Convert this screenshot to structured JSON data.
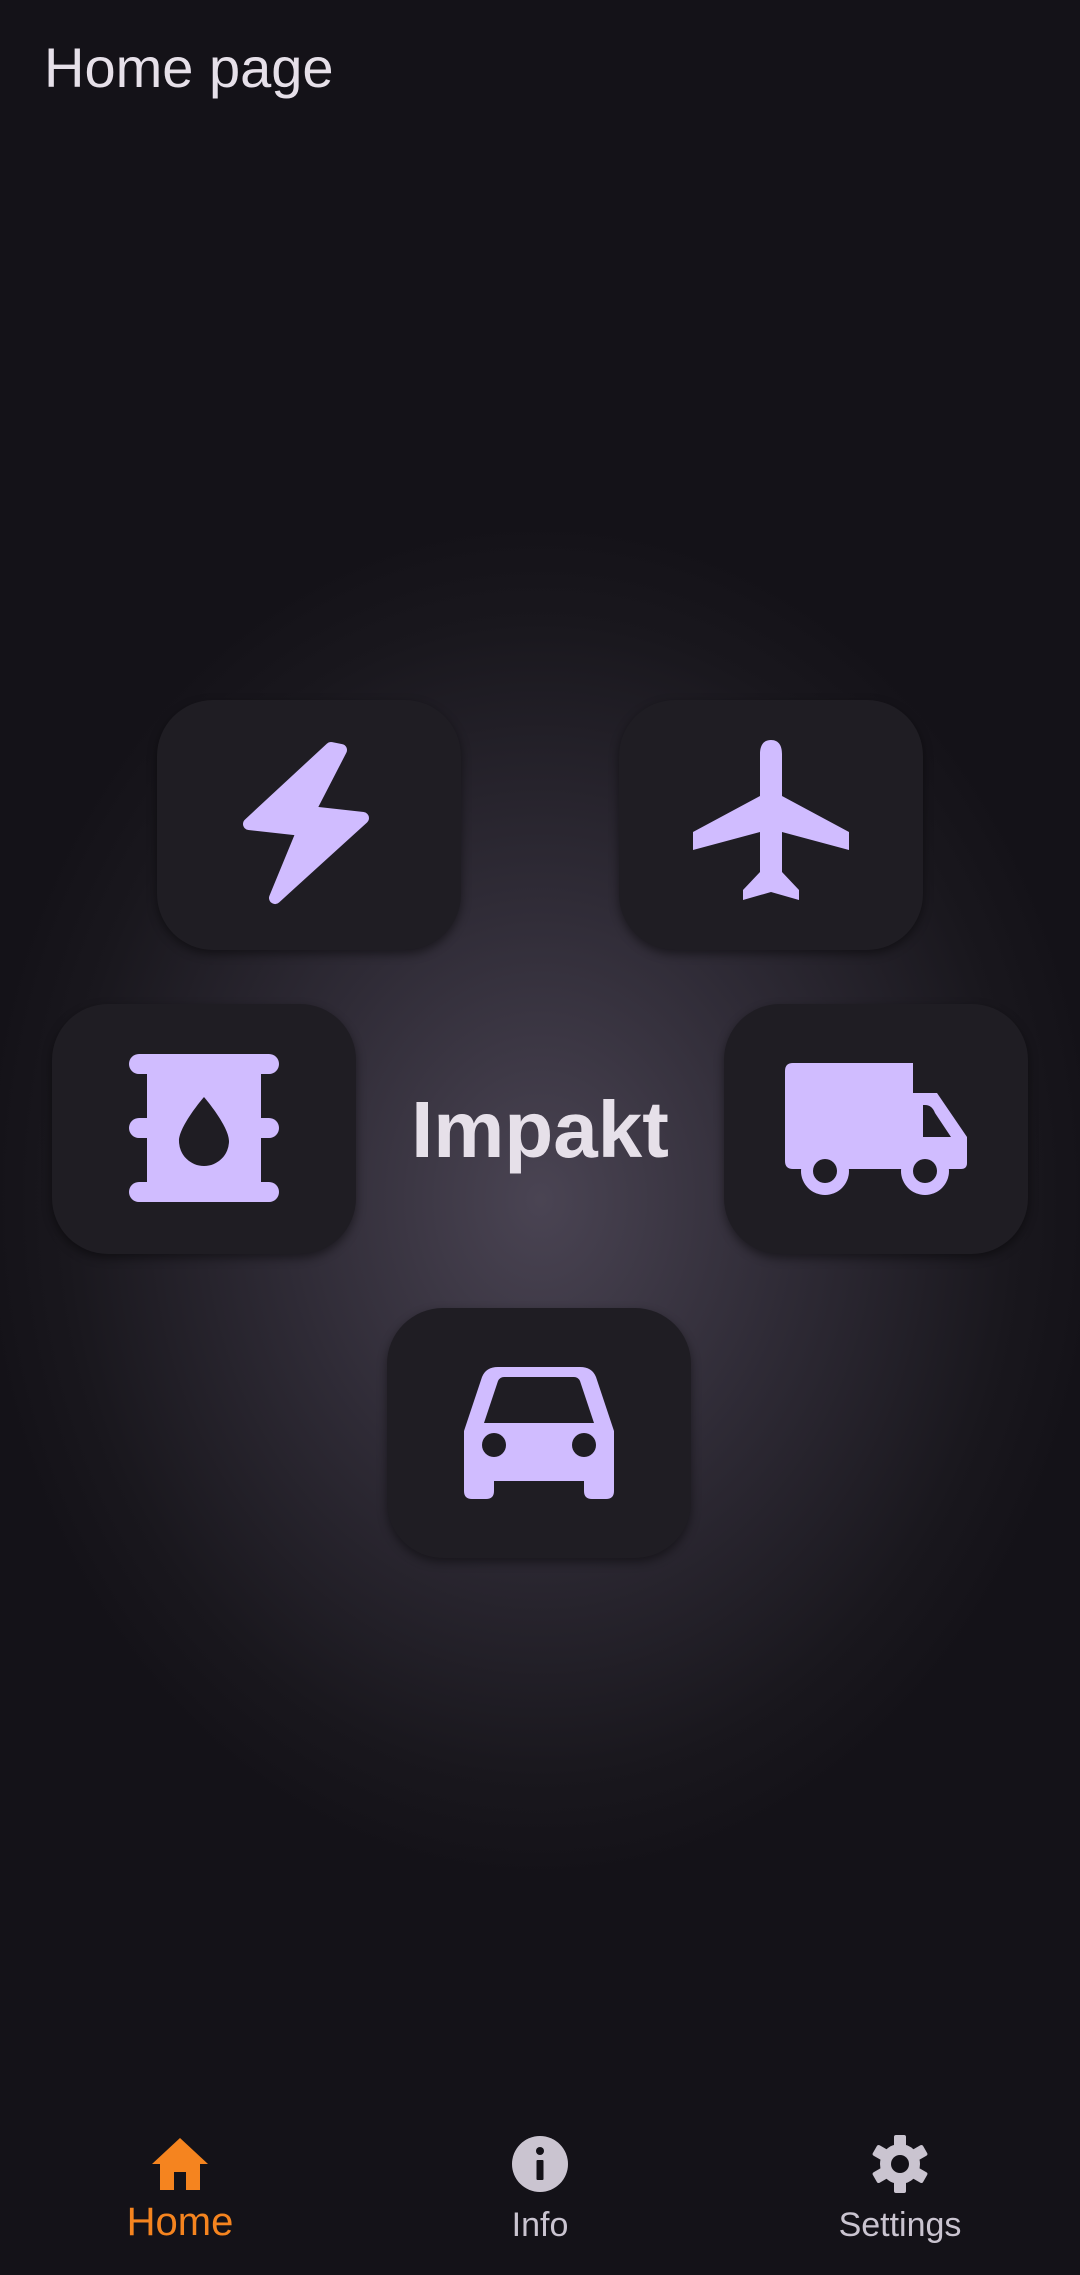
{
  "app_bar": {
    "title": "Home page"
  },
  "brand": {
    "name": "Impakt"
  },
  "tiles": [
    {
      "icon": "lightning-bolt-icon"
    },
    {
      "icon": "airplane-icon"
    },
    {
      "icon": "oil-barrel-icon"
    },
    {
      "icon": "truck-icon"
    },
    {
      "icon": "car-icon"
    }
  ],
  "bottom_nav": {
    "items": [
      {
        "label": "Home",
        "icon": "home-icon",
        "selected": true
      },
      {
        "label": "Info",
        "icon": "info-icon",
        "selected": false
      },
      {
        "label": "Settings",
        "icon": "gear-icon",
        "selected": false
      }
    ]
  },
  "colors": {
    "icon_accent": "#d0bcff",
    "active_nav": "#f5841f",
    "inactive_nav": "#cac4d0",
    "tile_background": "#1f1d23",
    "background": "#141218"
  }
}
